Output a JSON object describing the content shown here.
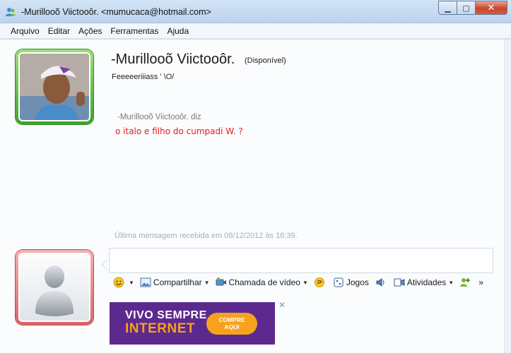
{
  "window": {
    "title": "-Murillooõ Viictooôr. <mumucaca@hotmail.com>",
    "minimize_glyph": "▁",
    "maximize_glyph": "▢",
    "close_glyph": "✕"
  },
  "menu": [
    "Arquivo",
    "Editar",
    "Ações",
    "Ferramentas",
    "Ajuda"
  ],
  "contact": {
    "name": "-Murillooõ Viictooôr.",
    "status": "(Disponível)",
    "personal_message": "Feeeeeriiiass '   \\O/"
  },
  "conversation": {
    "sender_line": "-Murillooõ Viictooôr. diz",
    "message": "o italo e filho do cumpadi W. ?"
  },
  "last_message_info": "Última mensagem recebida em 08/12/2012 às 16:39.",
  "toolbar": {
    "share": "Compartilhar",
    "video_call": "Chamada de vídeo",
    "games": "Jogos",
    "activities": "Atividades",
    "more": "»",
    "dropdown_glyph": "▼"
  },
  "ad": {
    "line1": "VIVO SEMPRE",
    "line2": "INTERNET",
    "button_line1": "COMPRE",
    "button_line2": "AQUI",
    "close_glyph": "✕"
  },
  "colors": {
    "message_text": "#e31b1b",
    "ad_background": "#5c2a8e",
    "ad_accent": "#f7a21c",
    "online_frame": "#3aa42c",
    "self_frame": "#d86666"
  }
}
